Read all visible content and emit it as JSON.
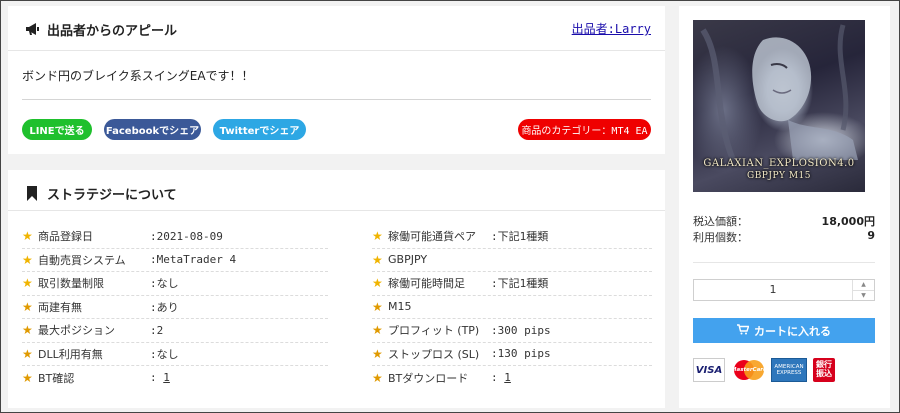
{
  "appeal": {
    "title": "出品者からのアピール",
    "icon": "megaphone-icon",
    "seller_link": "出品者:Larry",
    "body": "ボンド円のブレイク系スイングEAです！！",
    "share": {
      "line": "LINEで送る",
      "facebook": "Facebookでシェア",
      "twitter": "Twitterでシェア"
    },
    "category": "商品のカテゴリー：MT4 EA"
  },
  "strategy": {
    "title": "ストラテジーについて",
    "icon": "bookmark-icon",
    "left": [
      {
        "label": "商品登録日",
        "value": ":2021-08-09"
      },
      {
        "label": "自動売買システム",
        "value": ":MetaTrader 4"
      },
      {
        "label": "取引数量制限",
        "value": ":なし"
      },
      {
        "label": "両建有無",
        "value": ":あり"
      },
      {
        "label": "最大ポジション",
        "value": ":2"
      },
      {
        "label": "DLL利用有無",
        "value": ":なし"
      },
      {
        "label": "BT確認",
        "value_prefix": ": ",
        "value_link": "1"
      }
    ],
    "right": [
      {
        "label": "稼働可能通貨ペア",
        "value": ":下記1種類"
      },
      {
        "label": "GBPJPY",
        "value": ""
      },
      {
        "label": "稼働可能時間足",
        "value": ":下記1種類"
      },
      {
        "label": "M15",
        "value": ""
      },
      {
        "label": "プロフィット (TP)",
        "value": ":300 pips"
      },
      {
        "label": "ストップロス (SL)",
        "value": ":130 pips"
      },
      {
        "label": "BTダウンロード",
        "value_prefix": ": ",
        "value_link": "1"
      }
    ]
  },
  "product": {
    "image_caption_1": "GALAXIAN_EXPLOSION4.0",
    "image_caption_2": "GBPJPY M15",
    "price_label": "税込価額：",
    "price_value": "18,000円",
    "uses_label": "利用個数：",
    "uses_value": "9",
    "quantity": "1",
    "cart_button": "カートに入れる",
    "payment": {
      "visa": "VISA",
      "mastercard": "MasterCard",
      "amex_line1": "AMERICAN",
      "amex_line2": "EXPRESS",
      "bank_line1": "銀行",
      "bank_line2": "振込"
    }
  },
  "colors": {
    "line": "#1fc02d",
    "facebook": "#3b5998",
    "twitter": "#2da7e4",
    "category": "#ef0000",
    "cart": "#43a2ee",
    "star": "#f0b400"
  }
}
